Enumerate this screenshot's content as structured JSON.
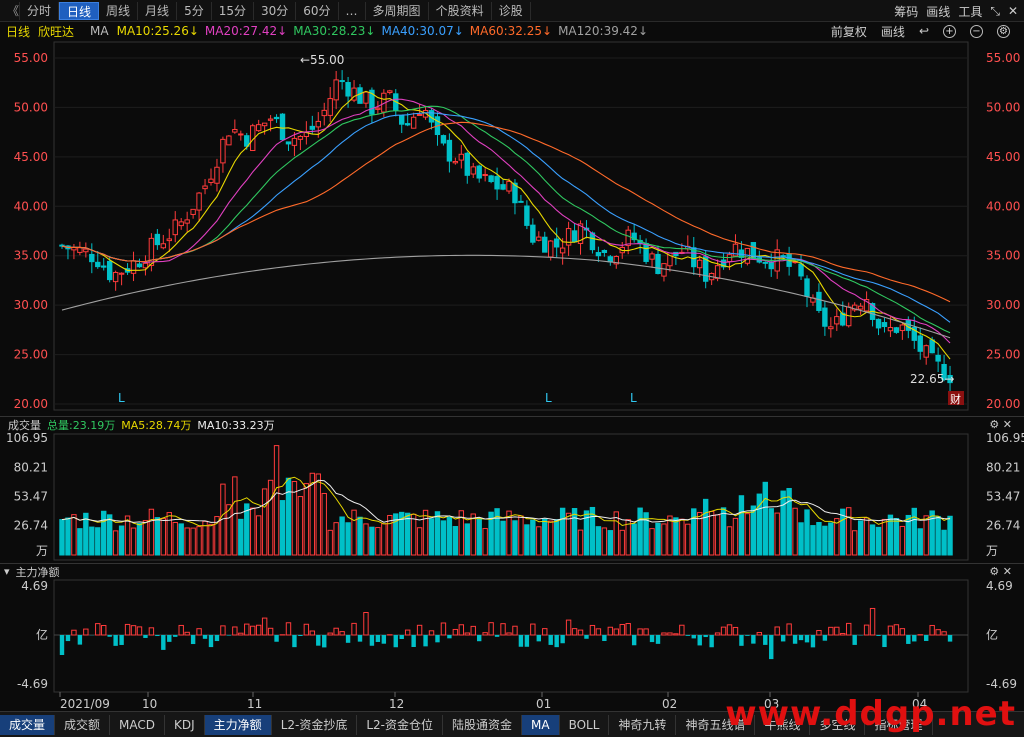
{
  "toolbar": {
    "back": "《",
    "tabs": [
      "分时",
      "日线",
      "周线",
      "月线",
      "5分",
      "15分",
      "30分",
      "60分",
      "…",
      "多周期图",
      "个股资料",
      "诊股"
    ],
    "active_index": 1,
    "right": [
      "筹码",
      "画线",
      "工具"
    ]
  },
  "infobar": {
    "period": "日线",
    "name": "欣旺达",
    "ma_label": "MA",
    "ma": [
      {
        "text": "MA10:25.26",
        "color": "#e8d800"
      },
      {
        "text": "MA20:27.42",
        "color": "#e040c0"
      },
      {
        "text": "MA30:28.23",
        "color": "#30c860"
      },
      {
        "text": "MA40:30.07",
        "color": "#3aa0ff"
      },
      {
        "text": "MA60:32.25",
        "color": "#ff6a2a"
      },
      {
        "text": "MA120:39.42",
        "color": "#a0a0a0"
      }
    ],
    "right": [
      "前复权",
      "画线"
    ]
  },
  "price_axis": {
    "ticks": [
      55,
      50,
      45,
      40,
      35,
      30,
      25,
      20
    ],
    "high_label": "55.00",
    "low_label": "22.65",
    "cai": "财"
  },
  "volume": {
    "title": "成交量",
    "total": "总量:23.19万",
    "ma5": "MA5:28.74万",
    "ma10": "MA10:33.23万",
    "ticks": [
      "106.95",
      "80.21",
      "53.47",
      "26.74"
    ],
    "unit": "万"
  },
  "flow": {
    "title": "主力净额",
    "max": "4.69",
    "min": "-4.69",
    "unit": "亿"
  },
  "date_axis": [
    "2021/09",
    "10",
    "11",
    "12",
    "01",
    "02",
    "03",
    "04"
  ],
  "colors": {
    "up": "#ff3b3b",
    "down": "#00c0c8"
  },
  "bottom_tabs": [
    "成交量",
    "成交额",
    "MACD",
    "KDJ",
    "主力净额",
    "L2-资金抄底",
    "L2-资金仓位",
    "陆股通资金",
    "MA",
    "BOLL",
    "神奇九转",
    "神奇五线谱",
    "牛熊线",
    "多空线",
    "指标管理"
  ],
  "bottom_active": [
    0,
    4,
    8
  ],
  "watermark": "www.ddgp.net"
}
